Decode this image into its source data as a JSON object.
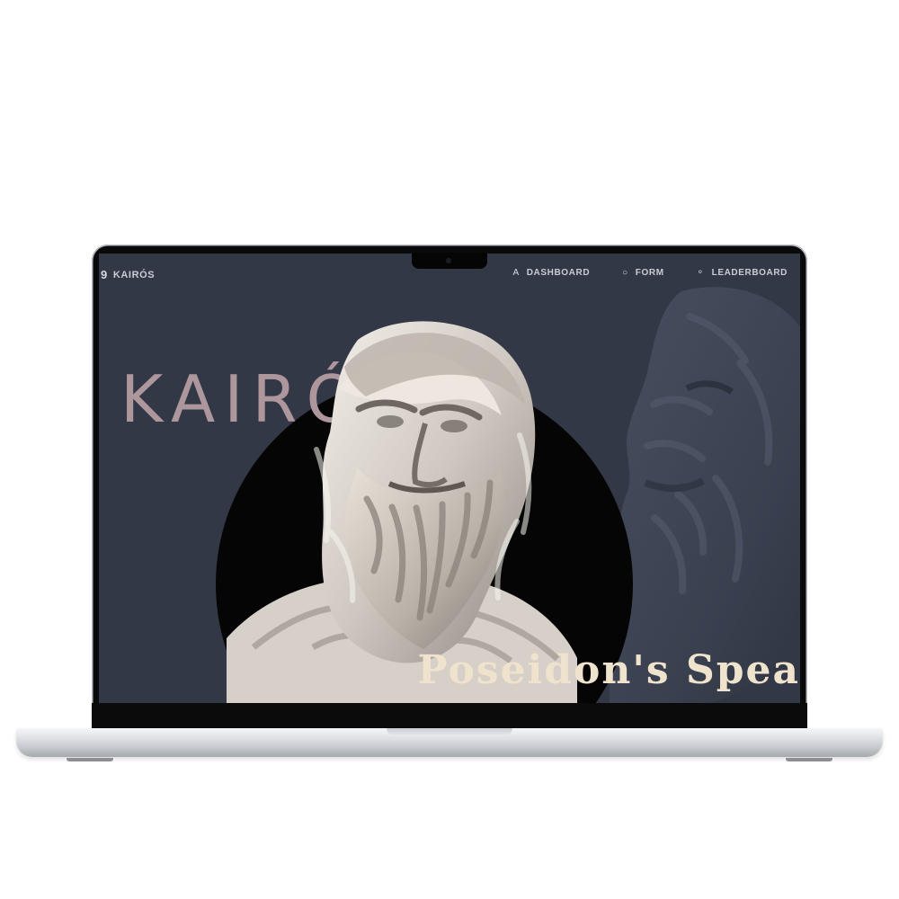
{
  "site": {
    "brand_icon": "9",
    "brand_name": "KAIRÓS",
    "nav": [
      {
        "icon": "A",
        "label": "DASHBOARD"
      },
      {
        "icon": "○",
        "label": "FORM"
      },
      {
        "icon": "⚬",
        "label": "LEADERBOARD"
      }
    ],
    "hero_title": "KAIRÓS",
    "caption": "Poseidon's Spea"
  },
  "colors": {
    "screen_background": "#333846",
    "disc": "#050505",
    "title": "#ad979c",
    "caption": "#f0e3cd"
  },
  "icons": {
    "camera": "camera-icon",
    "brand": "brand-icon"
  }
}
